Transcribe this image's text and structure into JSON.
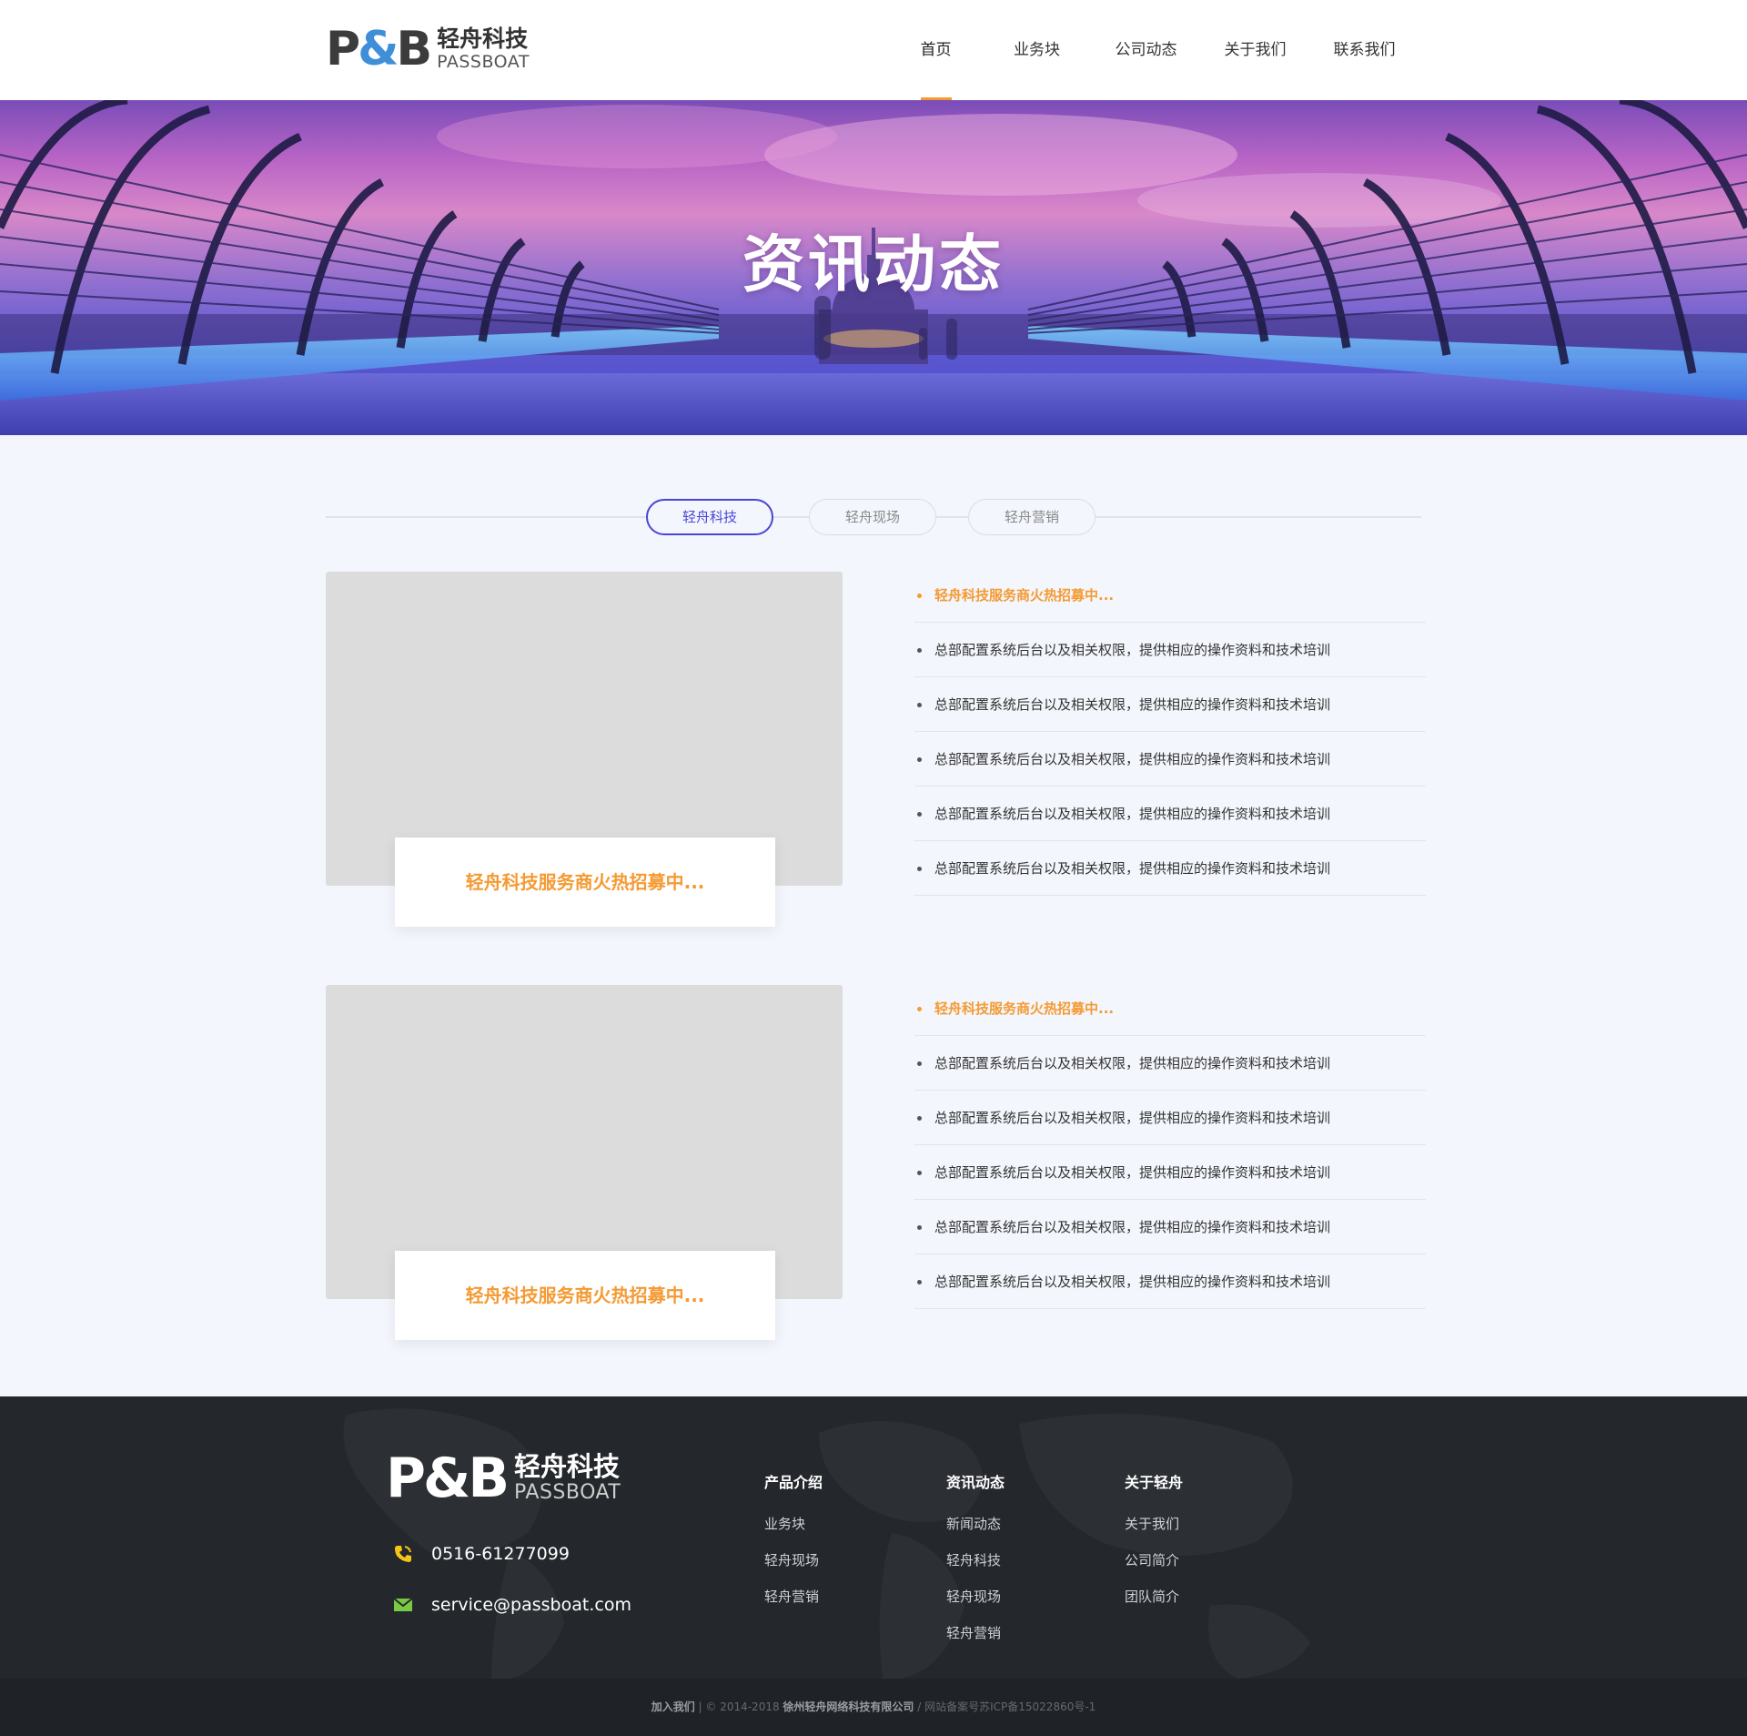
{
  "header": {
    "logo_mark_left": "P",
    "logo_mark_amp": "&",
    "logo_mark_right": "B",
    "logo_cn": "轻舟科技",
    "logo_en": "PASSBOAT",
    "nav": [
      {
        "label": "首页",
        "active": true
      },
      {
        "label": "业务块"
      },
      {
        "label": "公司动态"
      },
      {
        "label": "关于我们"
      },
      {
        "label": "联系我们"
      }
    ]
  },
  "banner": {
    "title": "资讯动态"
  },
  "tabs": [
    {
      "label": "轻舟科技",
      "active": true
    },
    {
      "label": "轻舟现场"
    },
    {
      "label": "轻舟营销"
    }
  ],
  "sections": [
    {
      "caption": "轻舟科技服务商火热招募中...",
      "list": [
        "轻舟科技服务商火热招募中...",
        "总部配置系统后台以及相关权限，提供相应的操作资料和技术培训",
        "总部配置系统后台以及相关权限，提供相应的操作资料和技术培训",
        "总部配置系统后台以及相关权限，提供相应的操作资料和技术培训",
        "总部配置系统后台以及相关权限，提供相应的操作资料和技术培训",
        "总部配置系统后台以及相关权限，提供相应的操作资料和技术培训"
      ]
    },
    {
      "caption": "轻舟科技服务商火热招募中...",
      "list": [
        "轻舟科技服务商火热招募中...",
        "总部配置系统后台以及相关权限，提供相应的操作资料和技术培训",
        "总部配置系统后台以及相关权限，提供相应的操作资料和技术培训",
        "总部配置系统后台以及相关权限，提供相应的操作资料和技术培训",
        "总部配置系统后台以及相关权限，提供相应的操作资料和技术培训",
        "总部配置系统后台以及相关权限，提供相应的操作资料和技术培训"
      ]
    }
  ],
  "footer": {
    "logo_cn": "轻舟科技",
    "logo_en": "PASSBOAT",
    "phone": "0516-61277099",
    "email": "service@passboat.com",
    "columns": [
      {
        "title": "产品介绍",
        "links": [
          "业务块",
          "轻舟现场",
          "轻舟营销"
        ]
      },
      {
        "title": "资讯动态",
        "links": [
          "新闻动态",
          "轻舟科技",
          "轻舟现场",
          "轻舟营销"
        ]
      },
      {
        "title": "关于轻舟",
        "links": [
          "关于我们",
          "公司简介",
          "团队简介"
        ]
      }
    ],
    "copyright": {
      "join": "加入我们",
      "sep1": " | ",
      "years": "© 2014-2018 ",
      "company": "徐州轻舟网络科技有限公司",
      "sep2": "  /  ",
      "icp": "网站备案号苏ICP备15022860号-1"
    }
  },
  "colors": {
    "accent_orange": "#f59a33",
    "tab_active_blue": "#4b45d6",
    "footer_bg": "#24272b",
    "phone_icon": "#f5c518",
    "mail_icon": "#7ac943"
  }
}
